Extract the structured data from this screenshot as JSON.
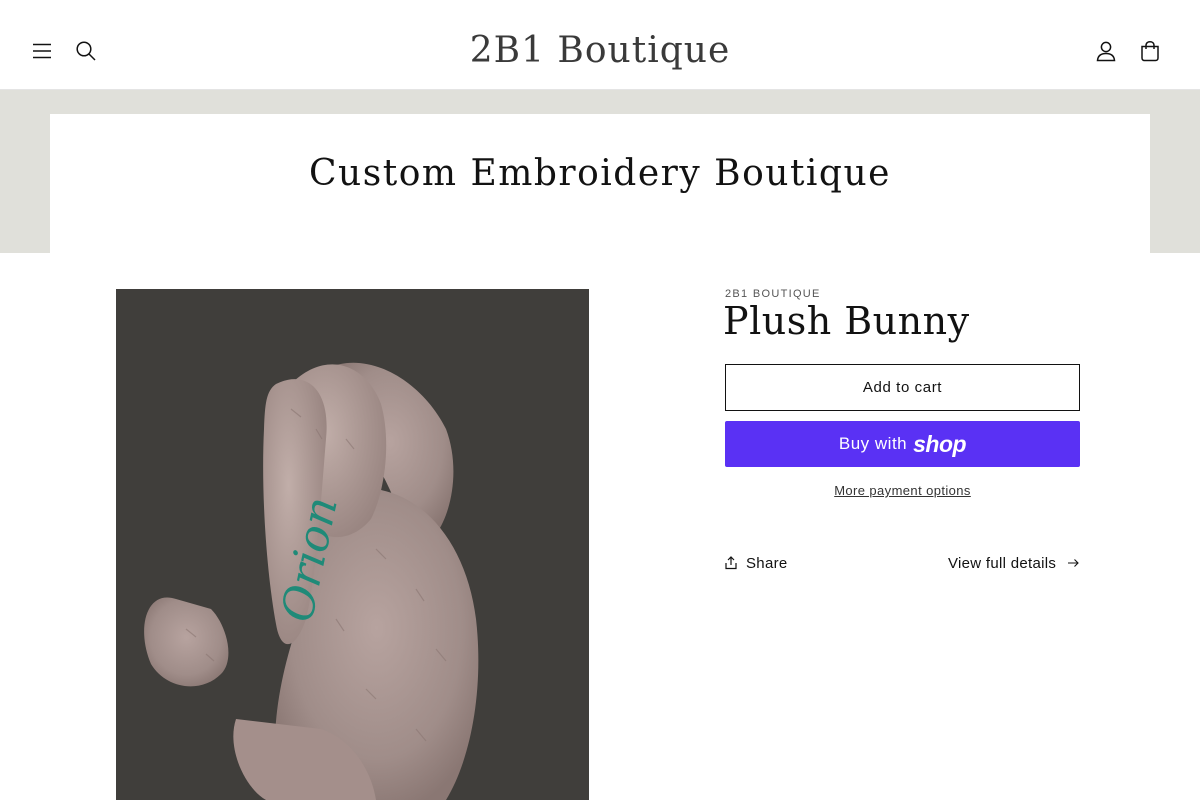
{
  "header": {
    "logo": "2B1 Boutique",
    "icons": {
      "menu": "hamburger-menu-icon",
      "search": "search-icon",
      "account": "account-icon",
      "cart": "cart-icon"
    }
  },
  "banner": {
    "title": "Custom Embroidery Boutique"
  },
  "product": {
    "vendor": "2B1 BOUTIQUE",
    "title": "Plush Bunny",
    "image_embroidery_text": "Orion",
    "add_to_cart_label": "Add to cart",
    "buy_now": {
      "label": "Buy with",
      "brand": "shop"
    },
    "more_payment_options": "More payment options",
    "share_label": "Share",
    "view_details_label": "View full details"
  },
  "colors": {
    "banner_bg": "#e0e0da",
    "shop_pay": "#5a31f4",
    "image_bg": "#403e3b",
    "embroidery": "#1f8a78"
  }
}
